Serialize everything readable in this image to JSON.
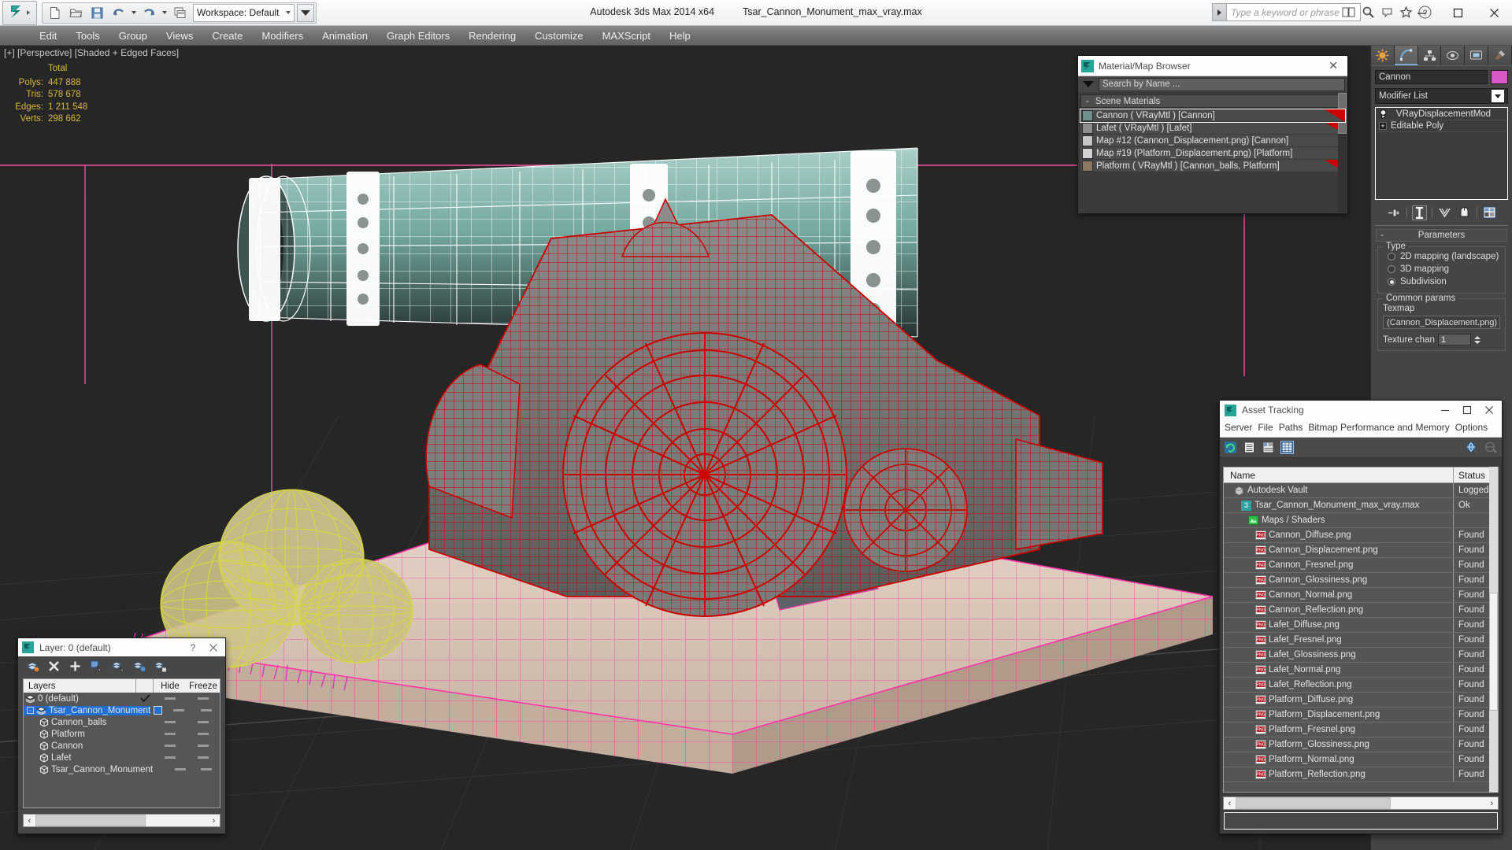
{
  "app": {
    "title": "Autodesk 3ds Max  2014 x64",
    "filename": "Tsar_Cannon_Monument_max_vray.max",
    "workspace_label": "Workspace: Default",
    "search_placeholder": "Type a keyword or phrase"
  },
  "window_controls": {
    "minimize": "—",
    "maximize": "☐",
    "close": "✕"
  },
  "menu": {
    "items": [
      "Edit",
      "Tools",
      "Group",
      "Views",
      "Create",
      "Modifiers",
      "Animation",
      "Graph Editors",
      "Rendering",
      "Customize",
      "MAXScript",
      "Help"
    ]
  },
  "quick_access": {
    "icons": [
      "new-file-icon",
      "open-file-icon",
      "save-file-icon",
      "undo-icon",
      "redo-icon",
      "scene-explorer-icon"
    ]
  },
  "viewport": {
    "label": "[+] [Perspective] [Shaded + Edged Faces]",
    "stats_header": "Total",
    "stats": [
      {
        "label": "Polys:",
        "value": "447 888"
      },
      {
        "label": "Tris:",
        "value": "578 678"
      },
      {
        "label": "Edges:",
        "value": "1 211 548"
      },
      {
        "label": "Verts:",
        "value": "298 662"
      }
    ],
    "colors": {
      "background": "#262626",
      "grid": "#3a3a3a",
      "selected_wire": "#cc0000",
      "cannon_wire": "#ffffff",
      "cannon_body": "#7fb5ab",
      "platform_wire": "#ff33aa",
      "balls_wire": "#d8d83a",
      "grass": "#e030c0"
    }
  },
  "material_browser": {
    "title": "Material/Map Browser",
    "close_label": "✕",
    "search_placeholder": "Search by Name ...",
    "group_header": "Scene Materials",
    "group_minus": "-",
    "materials": [
      {
        "name": "Cannon  ( VRayMtl )  [Cannon]",
        "swatch": "#6f8f8c",
        "selected": true,
        "flag": true
      },
      {
        "name": "Lafet  ( VRayMtl )  [Lafet]",
        "swatch": "#8e8e8c",
        "selected": false,
        "flag": true
      },
      {
        "name": "Map #12 (Cannon_Displacement.png)  [Cannon]",
        "swatch": "#c5c5c5",
        "selected": false,
        "flag": false
      },
      {
        "name": "Map #19 (Platform_Displacement.png)  [Platform]",
        "swatch": "#d2d2d2",
        "selected": false,
        "flag": false
      },
      {
        "name": "Platform  ( VRayMtl )  [Cannon_balls, Platform]",
        "swatch": "#8b7a63",
        "selected": false,
        "flag": true
      }
    ]
  },
  "command_panel": {
    "tabs": [
      "create-tab",
      "modify-tab",
      "hierarchy-tab",
      "motion-tab",
      "display-tab",
      "utilities-tab"
    ],
    "active_tab_index": 1,
    "object_name": "Cannon",
    "object_color": "#d957c8",
    "modifier_list_label": "Modifier List",
    "stack": [
      {
        "label": "VRayDisplacementMod",
        "type": "modifier"
      },
      {
        "label": "Editable Poly",
        "type": "base"
      }
    ],
    "stack_tools": [
      "pin-stack-icon",
      "show-end-result-icon",
      "make-unique-icon",
      "remove-modifier-icon",
      "configure-modifier-sets-icon"
    ],
    "rollout": {
      "title": "Parameters",
      "minus": "-",
      "type_legend": "Type",
      "type_options": [
        {
          "label": "2D mapping (landscape)",
          "selected": false
        },
        {
          "label": "3D mapping",
          "selected": false
        },
        {
          "label": "Subdivision",
          "selected": true
        }
      ],
      "common_legend": "Common params",
      "texmap_label": "Texmap",
      "texmap_value": "(Cannon_Displacement.png)",
      "texture_chan_label": "Texture chan",
      "texture_chan_value": "1"
    }
  },
  "asset_tracking": {
    "title": "Asset Tracking",
    "window_controls": {
      "minimize": "—",
      "maximize": "☐",
      "close": "✕"
    },
    "menu": [
      "Server",
      "File",
      "Paths",
      "Bitmap Performance and Memory",
      "Options"
    ],
    "toolbar_icons": [
      "refresh-icon",
      "list-view-icon",
      "details-view-icon",
      "grid-view-icon",
      "add-vault-icon",
      "vault-login-icon"
    ],
    "columns": [
      "Name",
      "Status"
    ],
    "rows": [
      {
        "name": "Autodesk Vault",
        "status": "Logged",
        "indent": 1,
        "icon": "vault-icon"
      },
      {
        "name": "Tsar_Cannon_Monument_max_vray.max",
        "status": "Ok",
        "indent": 2,
        "icon": "max-file-icon"
      },
      {
        "name": "Maps / Shaders",
        "status": "",
        "indent": 3,
        "icon": "maps-icon"
      },
      {
        "name": "Cannon_Diffuse.png",
        "status": "Found",
        "indent": 4,
        "icon": "png-icon"
      },
      {
        "name": "Cannon_Displacement.png",
        "status": "Found",
        "indent": 4,
        "icon": "png-icon"
      },
      {
        "name": "Cannon_Fresnel.png",
        "status": "Found",
        "indent": 4,
        "icon": "png-icon"
      },
      {
        "name": "Cannon_Glossiness.png",
        "status": "Found",
        "indent": 4,
        "icon": "png-icon"
      },
      {
        "name": "Cannon_Normal.png",
        "status": "Found",
        "indent": 4,
        "icon": "png-icon"
      },
      {
        "name": "Cannon_Reflection.png",
        "status": "Found",
        "indent": 4,
        "icon": "png-icon"
      },
      {
        "name": "Lafet_Diffuse.png",
        "status": "Found",
        "indent": 4,
        "icon": "png-icon"
      },
      {
        "name": "Lafet_Fresnel.png",
        "status": "Found",
        "indent": 4,
        "icon": "png-icon"
      },
      {
        "name": "Lafet_Glossiness.png",
        "status": "Found",
        "indent": 4,
        "icon": "png-icon"
      },
      {
        "name": "Lafet_Normal.png",
        "status": "Found",
        "indent": 4,
        "icon": "png-icon"
      },
      {
        "name": "Lafet_Reflection.png",
        "status": "Found",
        "indent": 4,
        "icon": "png-icon"
      },
      {
        "name": "Platform_Diffuse.png",
        "status": "Found",
        "indent": 4,
        "icon": "png-icon"
      },
      {
        "name": "Platform_Displacement.png",
        "status": "Found",
        "indent": 4,
        "icon": "png-icon"
      },
      {
        "name": "Platform_Fresnel.png",
        "status": "Found",
        "indent": 4,
        "icon": "png-icon"
      },
      {
        "name": "Platform_Glossiness.png",
        "status": "Found",
        "indent": 4,
        "icon": "png-icon"
      },
      {
        "name": "Platform_Normal.png",
        "status": "Found",
        "indent": 4,
        "icon": "png-icon"
      },
      {
        "name": "Platform_Reflection.png",
        "status": "Found",
        "indent": 4,
        "icon": "png-icon"
      }
    ],
    "scroll_left_arrow": "‹",
    "scroll_right_arrow": "›"
  },
  "layer_dialog": {
    "title": "Layer: 0 (default)",
    "help_label": "?",
    "close_label": "✕",
    "toolbar_icons": [
      "create-new-layer-icon",
      "delete-layer-icon",
      "add-selection-icon",
      "select-objects-in-layer-icon",
      "select-highlighted-icon",
      "highlight-selected-icon",
      "layer-properties-icon"
    ],
    "columns": {
      "name": "Layers",
      "hide": "Hide",
      "freeze": "Freeze"
    },
    "rows": [
      {
        "name": "0 (default)",
        "indent": 1,
        "selected": false,
        "current": true,
        "icon": "layer-icon",
        "expander": ""
      },
      {
        "name": "Tsar_Cannon_Monument",
        "indent": 1,
        "selected": true,
        "current": false,
        "icon": "layer-icon",
        "expander": "-"
      },
      {
        "name": "Cannon_balls",
        "indent": 2,
        "selected": false,
        "current": false,
        "icon": "object-icon",
        "expander": ""
      },
      {
        "name": "Platform",
        "indent": 2,
        "selected": false,
        "current": false,
        "icon": "object-icon",
        "expander": ""
      },
      {
        "name": "Cannon",
        "indent": 2,
        "selected": false,
        "current": false,
        "icon": "object-icon",
        "expander": ""
      },
      {
        "name": "Lafet",
        "indent": 2,
        "selected": false,
        "current": false,
        "icon": "object-icon",
        "expander": ""
      },
      {
        "name": "Tsar_Cannon_Monument",
        "indent": 2,
        "selected": false,
        "current": false,
        "icon": "object-icon",
        "expander": ""
      }
    ],
    "scroll_left_arrow": "‹",
    "scroll_right_arrow": "›"
  }
}
